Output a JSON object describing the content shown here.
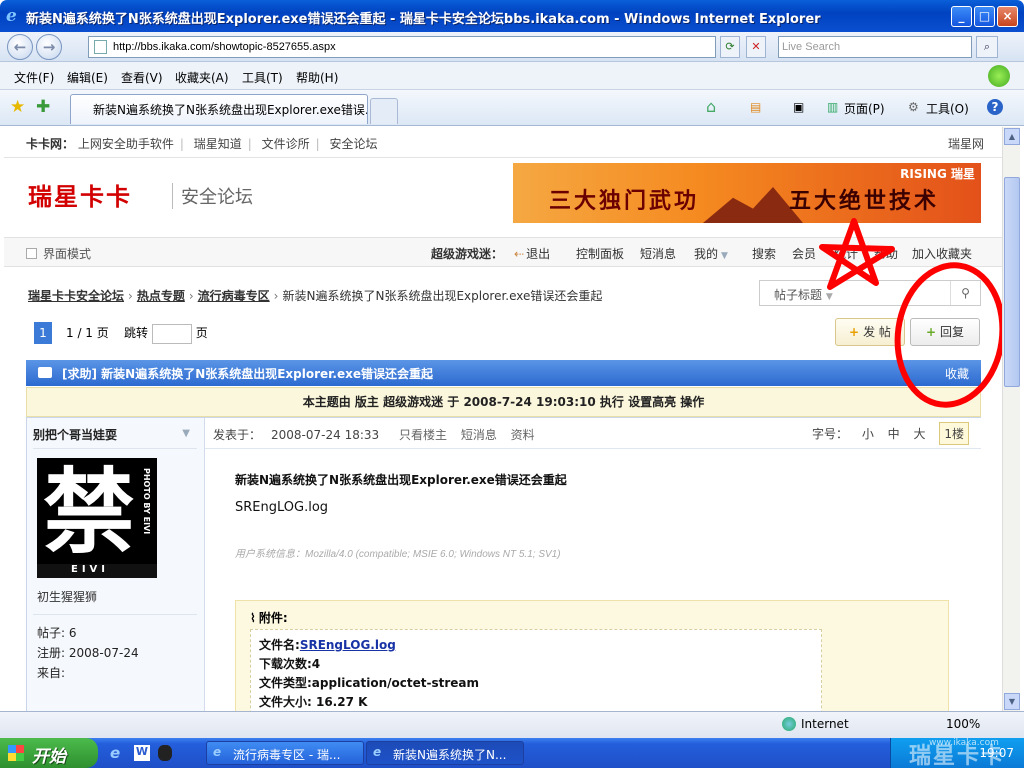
{
  "window": {
    "title": "新装N遍系统换了N张系统盘出现Explorer.exe错误还会重起 - 瑞星卡卡安全论坛bbs.ikaka.com - Windows Internet Explorer"
  },
  "address": {
    "url": "http://bbs.ikaka.com/showtopic-8527655.aspx",
    "search_placeholder": "Live Search"
  },
  "menu": [
    "文件(F)",
    "编辑(E)",
    "查看(V)",
    "收藏夹(A)",
    "工具(T)",
    "帮助(H)"
  ],
  "tab": {
    "title": "新装N遍系统换了N张系统盘出现Explorer.exe错误..."
  },
  "toolbar": {
    "page": "页面(P)",
    "tools": "工具(O)"
  },
  "site": {
    "top_label": "卡卡网：",
    "top_links": [
      "上网安全助手软件",
      "瑞星知道",
      "文件诊所",
      "安全论坛"
    ],
    "top_right": "瑞星网",
    "logo": "瑞星卡卡",
    "logo_sub": "安全论坛",
    "banner_left": "三大独门武功",
    "banner_right": "五大绝世技术",
    "banner_brand": "RISING 瑞星"
  },
  "nav": {
    "mode": "界面模式",
    "user": "超级游戏迷：",
    "links": [
      "退出",
      "控制面板",
      "短消息",
      "我的",
      "搜索",
      "会员",
      "统计",
      "帮助",
      "加入收藏夹"
    ]
  },
  "breadcrumb": {
    "items": [
      "瑞星卡卡安全论坛",
      "热点专题",
      "流行病毒专区"
    ],
    "current": "新装N遍系统换了N张系统盘出现Explorer.exe错误还会重起"
  },
  "search": {
    "select": "帖子标题"
  },
  "pager": {
    "current": "1",
    "pages": "1 / 1 页",
    "jump": "跳转",
    "page_unit": "页"
  },
  "buttons": {
    "post": "发 帖",
    "reply": "回复"
  },
  "thread": {
    "title": "[求助] 新装N遍系统换了N张系统盘出现Explorer.exe错误还会重起",
    "favorite": "收藏",
    "mod_line": "本主题由  版主  超级游戏迷  于  2008-7-24 19:03:10 执行  设置高亮  操作"
  },
  "post": {
    "user": "别把个哥当娃耍",
    "rank": "初生猩猩狮",
    "posts": "帖子: 6",
    "registered": "注册:  2008-07-24",
    "from": "来自:",
    "posted_label": "发表于：",
    "posted_time": "2008-07-24 18:33",
    "only_author": "只看楼主",
    "pm": "短消息",
    "profile": "资料",
    "font_label": "字号：",
    "font_small": "小",
    "font_mid": "中",
    "font_big": "大",
    "floor": "1楼",
    "title": "新装N遍系统换了N张系统盘出现Explorer.exe错误还会重起",
    "body": "SREngLOG.log",
    "ua": "用户系统信息：Mozilla/4.0 (compatible; MSIE 6.0; Windows NT 5.1; SV1)",
    "avatar_text": "禁",
    "avatar_side": "PHOTO BY EIVI",
    "avatar_bottom": "EIVI"
  },
  "attachment": {
    "label": "附件:",
    "filename_label": "文件名:",
    "filename": "SREngLOG.log",
    "downloads": "下载次数:4",
    "type": "文件类型:application/octet-stream",
    "size": "文件大小: 16.27 K"
  },
  "status": {
    "zone": "Internet",
    "zoom": "100%"
  },
  "taskbar": {
    "start": "开始",
    "tasks": [
      "流行病毒专区 - 瑞...",
      "新装N遍系统换了N..."
    ],
    "time": "19:07"
  },
  "watermark": {
    "brand": "瑞星卡卡",
    "url": "www.ikaka.com"
  },
  "colors": {
    "annotation": "#ff0000",
    "title_blue": "#0a4fd0",
    "brand_red": "#d20000"
  }
}
